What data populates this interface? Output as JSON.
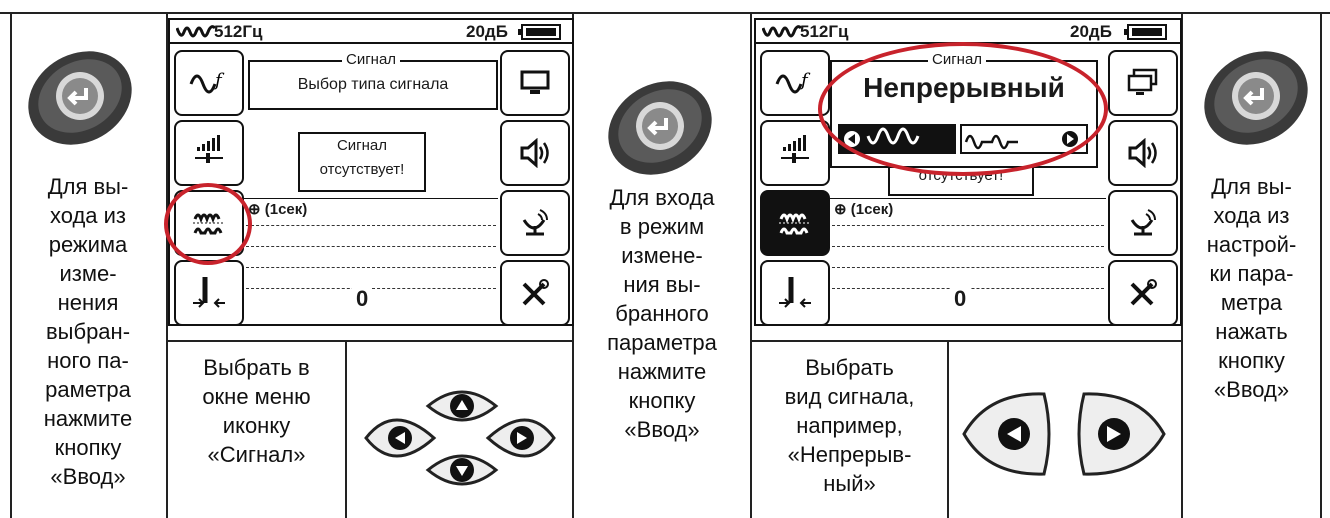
{
  "left_instruction": [
    "Для вы-",
    "хода из",
    "режима",
    "изме-",
    "нения",
    "выбран-",
    "ного па-",
    "раметра",
    "нажмите",
    "кнопку",
    "«Ввод»"
  ],
  "mid_instruction": [
    "Для входа",
    "в режим",
    "измене-",
    "ния вы-",
    "бранного",
    "параметра",
    "нажмите",
    "кнопку",
    "«Ввод»"
  ],
  "right_instruction": [
    "Для вы-",
    "хода из",
    "настрой-",
    "ки пара-",
    "метра",
    "нажать",
    "кнопку",
    "«Ввод»"
  ],
  "select_instruction": [
    "Выбрать в",
    "окне меню",
    "иконку",
    "«Сигнал»"
  ],
  "choose_instruction": [
    "Выбрать",
    "вид сигнала,",
    "например,",
    "«Непрерыв-",
    "ный»"
  ],
  "screen1": {
    "frequency": "512Гц",
    "level": "20дБ",
    "popup_title": "Сигнал",
    "popup_text": "Выбор типа сигнала",
    "alert_line1": "Сигнал",
    "alert_line2": "отсутствует!",
    "timer": "(1сек)",
    "value": "0"
  },
  "screen2": {
    "frequency": "512Гц",
    "level": "20дБ",
    "popup_title": "Сигнал",
    "signal_type": "Непрерывный",
    "alert_line2": "отсутствует!",
    "timer": "(1сек)",
    "value": "0"
  }
}
